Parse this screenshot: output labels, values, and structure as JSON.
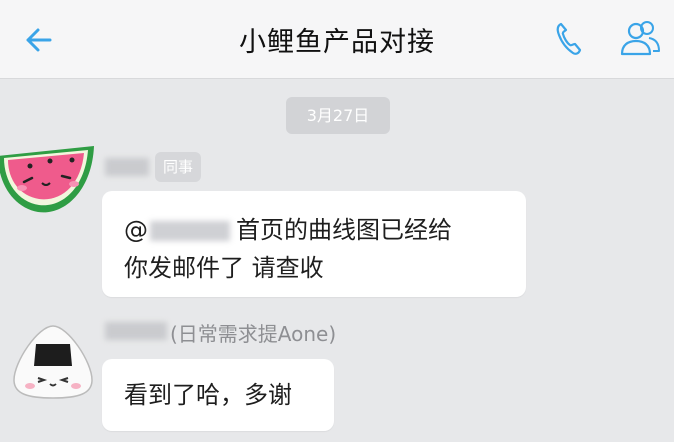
{
  "header": {
    "title": "小鲤鱼产品对接",
    "back_icon": "back-arrow-icon",
    "call_icon": "phone-icon",
    "members_icon": "group-members-icon",
    "accent_color": "#3aa4e8"
  },
  "chat": {
    "date_label": "3月27日",
    "messages": [
      {
        "sender_tag": "同事",
        "at_symbol": "@",
        "text_line1": "首页的曲线图已经给",
        "text_line2": "你发邮件了 请查收"
      },
      {
        "sender_nickname": "(日常需求提Aone)",
        "text": "看到了哈，多谢"
      }
    ]
  }
}
